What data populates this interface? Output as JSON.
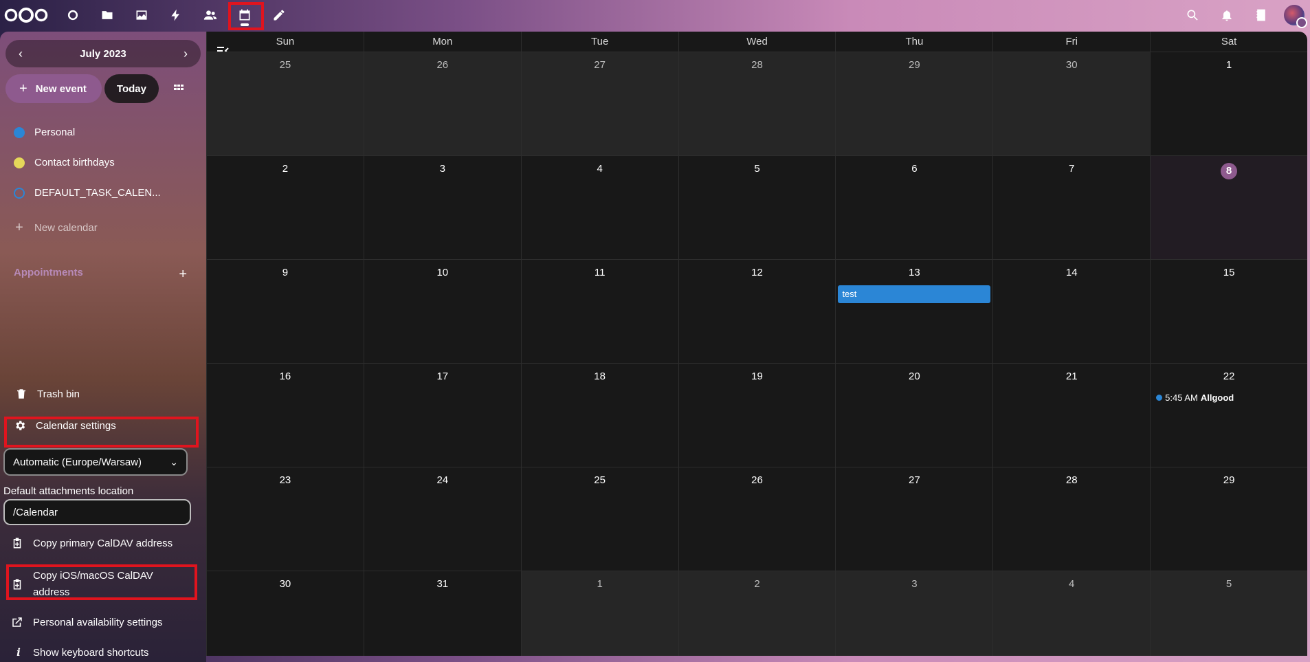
{
  "topbar": {
    "apps": [
      "dashboard",
      "files",
      "photos",
      "activity",
      "contacts",
      "calendar",
      "notes"
    ],
    "active_app": "calendar",
    "right": [
      "search",
      "notifications",
      "contacts-menu",
      "user-avatar"
    ]
  },
  "annotations": [
    "1",
    "2",
    "3"
  ],
  "sidebar": {
    "month": "July 2023",
    "new_event": "New event",
    "today": "Today",
    "calendars": [
      {
        "label": "Personal",
        "color": "#2b86d6"
      },
      {
        "label": "Contact birthdays",
        "color": "#e5d75a"
      },
      {
        "label": "DEFAULT_TASK_CALEN...",
        "color": "#2b86d6"
      }
    ],
    "new_calendar": "New calendar",
    "appointments": "Appointments",
    "trash": "Trash bin",
    "settings": "Calendar settings",
    "timezone": "Automatic (Europe/Warsaw)",
    "attach_label": "Default attachments location",
    "attach_value": "/Calendar",
    "copy_primary": "Copy primary CalDAV address",
    "copy_ios": "Copy iOS/macOS CalDAV address",
    "availability": "Personal availability settings",
    "shortcuts": "Show keyboard shortcuts"
  },
  "calendar": {
    "weekdays": [
      "Sun",
      "Mon",
      "Tue",
      "Wed",
      "Thu",
      "Fri",
      "Sat"
    ],
    "weeks": [
      [
        "25",
        "26",
        "27",
        "28",
        "29",
        "30",
        "1"
      ],
      [
        "2",
        "3",
        "4",
        "5",
        "6",
        "7",
        "8"
      ],
      [
        "9",
        "10",
        "11",
        "12",
        "13",
        "14",
        "15"
      ],
      [
        "16",
        "17",
        "18",
        "19",
        "20",
        "21",
        "22"
      ],
      [
        "23",
        "24",
        "25",
        "26",
        "27",
        "28",
        "29"
      ],
      [
        "30",
        "31",
        "1",
        "2",
        "3",
        "4",
        "5"
      ]
    ],
    "event_test": "test",
    "event_allgood_time": "5:45 AM",
    "event_allgood_title": "Allgood"
  }
}
